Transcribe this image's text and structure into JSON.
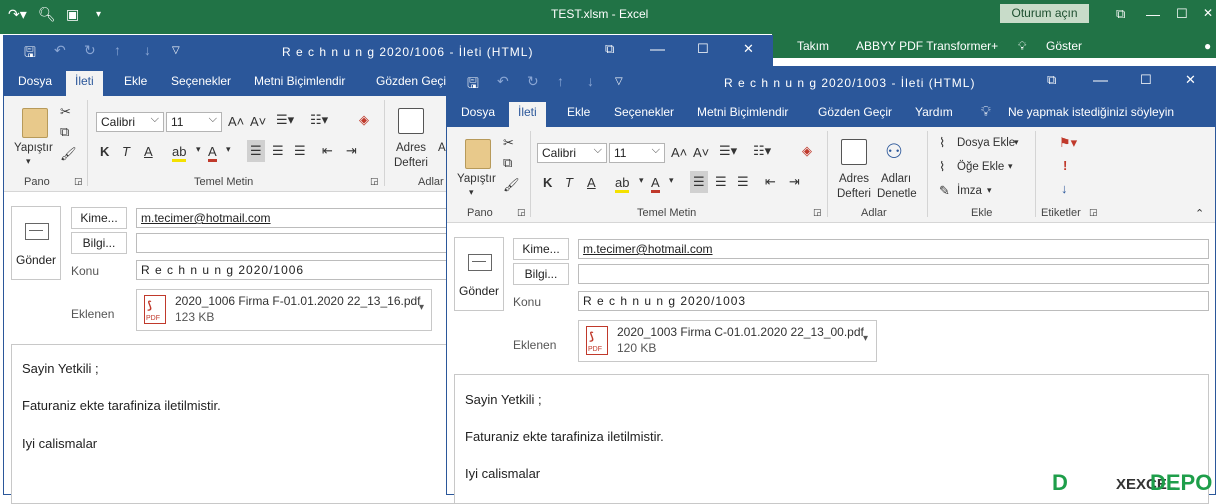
{
  "excel": {
    "title": "TEST.xlsm  -  Excel",
    "login_button": "Oturum açın",
    "ribbon_items": [
      "Takım",
      "ABBYY PDF Transformer+",
      "Göster"
    ]
  },
  "colors": {
    "outlook_blue": "#2b579a",
    "excel_green": "#217346"
  },
  "back_window": {
    "title": "R e c h n u n g  2020/1006  -  İleti (HTML)",
    "tabs": [
      "Dosya",
      "İleti",
      "Ekle",
      "Seçenekler",
      "Metni Biçimlendir",
      "Gözden Geçir"
    ],
    "ribbon": {
      "paste": "Yapıştır",
      "font": "Calibri",
      "size": "11",
      "group_pano": "Pano",
      "group_temel": "Temel Metin",
      "address_book_1": "Adres",
      "address_book_2": "Defteri",
      "check_names": "Ad",
      "group_adlar": "Adlar"
    },
    "send": "Gönder",
    "to_button": "Kime...",
    "cc_button": "Bilgi...",
    "subject_label": "Konu",
    "attached_label": "Eklenen",
    "to_value": "m.tecimer@hotmail.com",
    "cc_value": "",
    "subject_value": "R e c h n u n g  2020/1006",
    "attachment": {
      "name": "2020_1006 Firma F-01.01.2020 22_13_16.pdf",
      "size": "123 KB"
    },
    "body": [
      "Sayin Yetkili ;",
      "Faturaniz ekte tarafiniza iletilmistir.",
      "Iyi calismalar"
    ]
  },
  "front_window": {
    "title": "R e c h n u n g  2020/1003  -  İleti (HTML)",
    "tabs": [
      "Dosya",
      "İleti",
      "Ekle",
      "Seçenekler",
      "Metni Biçimlendir",
      "Gözden Geçir",
      "Yardım",
      "Ne yapmak istediğinizi söyleyin"
    ],
    "ribbon": {
      "paste": "Yapıştır",
      "font": "Calibri",
      "size": "11",
      "group_pano": "Pano",
      "group_temel": "Temel Metin",
      "address_book_1": "Adres",
      "address_book_2": "Defteri",
      "check_names_1": "Adları",
      "check_names_2": "Denetle",
      "group_adlar": "Adlar",
      "attach_file": "Dosya Ekle",
      "attach_item": "Öğe Ekle",
      "signature": "İmza",
      "group_ekle": "Ekle",
      "group_etiketler": "Etiketler"
    },
    "send": "Gönder",
    "to_button": "Kime...",
    "cc_button": "Bilgi...",
    "subject_label": "Konu",
    "attached_label": "Eklenen",
    "to_value": "m.tecimer@hotmail.com",
    "cc_value": "",
    "subject_value": "R e c h n u n g  2020/1003",
    "attachment": {
      "name": "2020_1003 Firma C-01.01.2020 22_13_00.pdf",
      "size": "120 KB"
    },
    "body": [
      "Sayin Yetkili ;",
      "Faturaniz ekte tarafiniza iletilmistir.",
      "Iyi calismalar"
    ]
  },
  "watermark": {
    "left": "XEXCEL",
    "right": "DEPO"
  }
}
